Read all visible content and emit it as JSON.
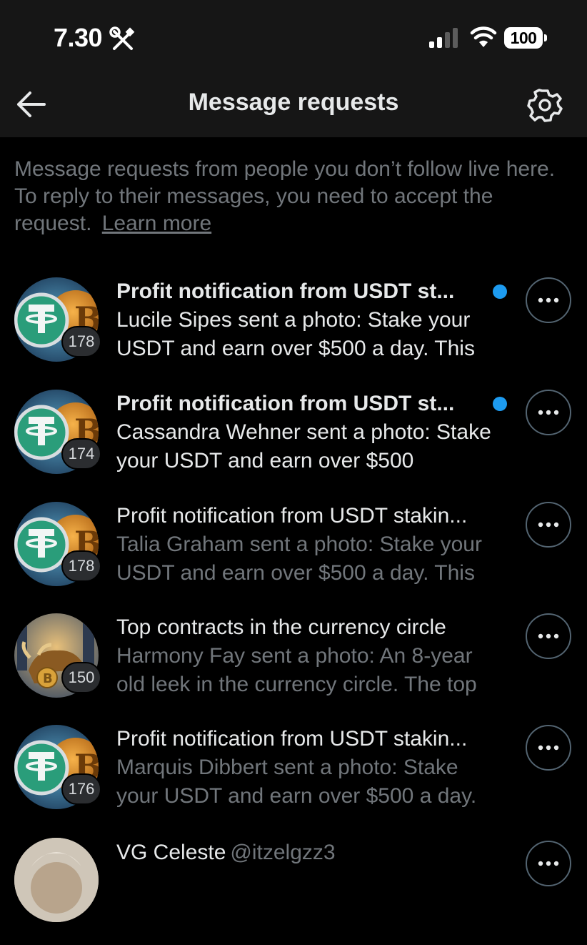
{
  "status_bar": {
    "time": "7.30",
    "battery": "100"
  },
  "header": {
    "title": "Message requests"
  },
  "intro": {
    "text": "Message requests from people you don’t follow live here. To reply to their messages, you need to accept the request.",
    "learn_more": "Learn more"
  },
  "requests": [
    {
      "title": "Profit notification from USDT st...",
      "preview": "Lucile Sipes sent a photo: Stake your USDT and earn over $500 a day. This",
      "badge": "178",
      "unread": true
    },
    {
      "title": "Profit notification from USDT st...",
      "preview": "Cassandra Wehner sent a photo: Stake your USDT and earn over $500",
      "badge": "174",
      "unread": true
    },
    {
      "title": "Profit notification from USDT stakin...",
      "preview": "Talia Graham sent a photo: Stake your USDT and earn over $500 a day. This",
      "badge": "178",
      "unread": false
    },
    {
      "title": "Top contracts in the currency circle",
      "preview": "Harmony Fay sent a photo: An 8-year old leek in the currency circle. The top",
      "badge": "150",
      "unread": false
    },
    {
      "title": "Profit notification from USDT stakin...",
      "preview": "Marquis Dibbert sent a photo: Stake your USDT and earn over $500 a day.",
      "badge": "176",
      "unread": false
    }
  ],
  "last_request": {
    "name": "VG Celeste",
    "handle": "@itzelgzz3"
  },
  "colors": {
    "background": "#000000",
    "header_bg": "#161616",
    "unread_dot": "#1d9bf0",
    "muted_text": "#71767b"
  }
}
